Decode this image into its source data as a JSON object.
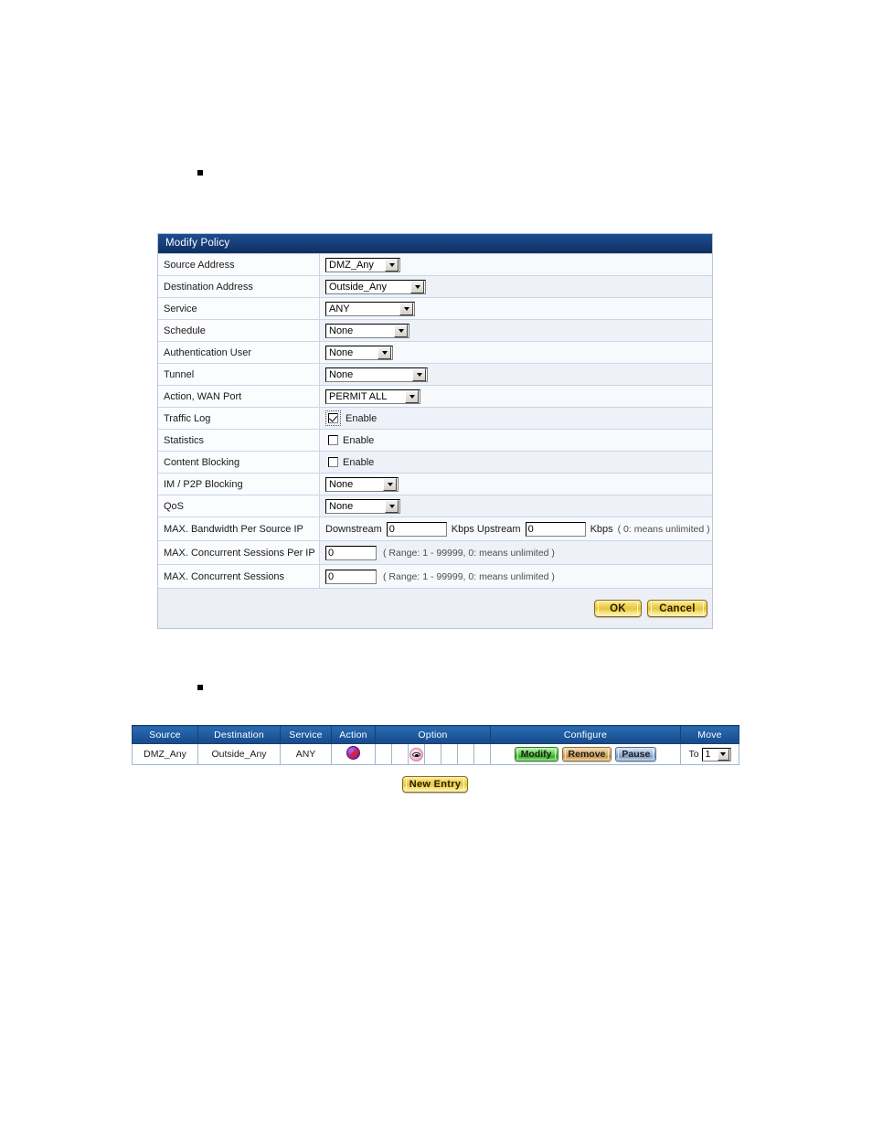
{
  "page": {
    "bullets": [
      "",
      ""
    ]
  },
  "policy_panel": {
    "title": "Modify Policy",
    "rows": [
      {
        "label": "Source Address",
        "type": "select",
        "value": "DMZ_Any"
      },
      {
        "label": "Destination Address",
        "type": "select",
        "value": "Outside_Any"
      },
      {
        "label": "Service",
        "type": "select",
        "value": "ANY"
      },
      {
        "label": "Schedule",
        "type": "select",
        "value": "None"
      },
      {
        "label": "Authentication User",
        "type": "select",
        "value": "None"
      },
      {
        "label": "Tunnel",
        "type": "select",
        "value": "None"
      },
      {
        "label": "Action, WAN Port",
        "type": "select",
        "value": "PERMIT ALL"
      },
      {
        "label": "Traffic Log",
        "type": "checkbox",
        "value": "Enable",
        "checked": true
      },
      {
        "label": "Statistics",
        "type": "checkbox",
        "value": "Enable",
        "checked": false
      },
      {
        "label": "Content Blocking",
        "type": "checkbox",
        "value": "Enable",
        "checked": false
      },
      {
        "label": "IM / P2P Blocking",
        "type": "select",
        "value": "None"
      },
      {
        "label": "QoS",
        "type": "select",
        "value": "None"
      },
      {
        "label": "MAX. Bandwidth Per Source IP",
        "type": "bandwidth"
      },
      {
        "label": "MAX. Concurrent Sessions Per IP",
        "type": "number",
        "value": "0",
        "hint": "( Range: 1 - 99999, 0: means unlimited )"
      },
      {
        "label": "MAX. Concurrent Sessions",
        "type": "number",
        "value": "0",
        "hint": "( Range: 1 - 99999, 0: means unlimited )"
      }
    ],
    "bandwidth": {
      "downstream_label": "Downstream",
      "downstream_value": "0",
      "kbps_upstream_label": "Kbps Upstream",
      "upstream_value": "0",
      "kbps_label": "Kbps",
      "hint": "( 0: means unlimited )"
    },
    "buttons": {
      "ok": "OK",
      "cancel": "Cancel"
    }
  },
  "policy_list": {
    "columns": [
      "Source",
      "Destination",
      "Service",
      "Action",
      "Option",
      "Configure",
      "Move"
    ],
    "rows": [
      {
        "source": "DMZ_Any",
        "destination": "Outside_Any",
        "service": "ANY",
        "action_icon": "permit-all-icon",
        "option_cells": 7,
        "option_icon_index": 2,
        "option_icon": "traffic-log-eye-icon",
        "configure": {
          "modify": "Modify",
          "remove": "Remove",
          "pause": "Pause"
        },
        "move": {
          "to_label": "To",
          "value": "1"
        }
      }
    ],
    "new_entry": "New Entry"
  },
  "colors": {
    "panel_header": "#17407c",
    "table_header": "#1f5ba0",
    "gold_button": "#e8c539",
    "modify_green": "#35a826",
    "remove_tan": "#c4954c",
    "pause_blue": "#7b9ac2"
  }
}
